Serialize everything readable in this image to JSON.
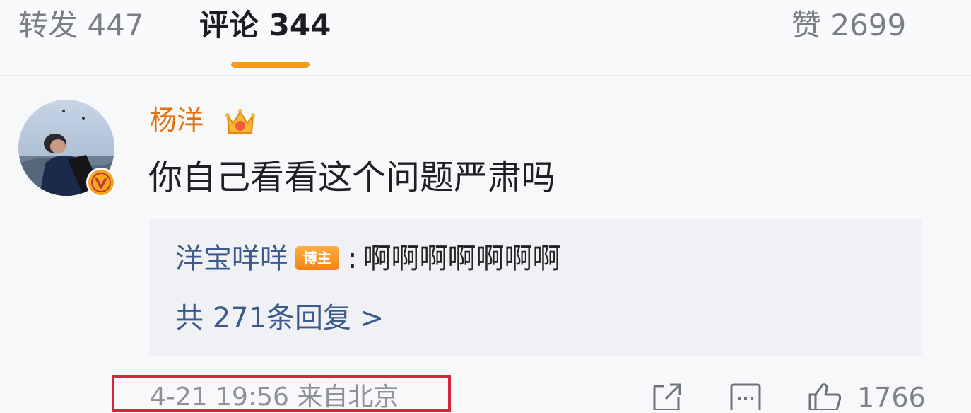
{
  "tabs": {
    "repost": "转发 447",
    "comments": "评论 344",
    "likes": "赞 2699"
  },
  "colors": {
    "accent": "#f49a1f",
    "username": "#e2730d",
    "link": "#3c5a8c",
    "highlight_box": "#d7263b"
  },
  "comment": {
    "author": "杨洋",
    "author_badge_icon": "crown-icon",
    "verified_icon": "v-badge-icon",
    "text": "你自己看看这个问题严肃吗",
    "reply_preview": {
      "author": "洋宝咩咩",
      "badge": "博主",
      "separator": ":",
      "text": "啊啊啊啊啊啊啊"
    },
    "more_replies": "共 271条回复 >",
    "meta": "4-21 19:56 来自北京",
    "actions": {
      "share_icon": "share-icon",
      "comment_icon": "comment-icon",
      "like_icon": "thumbs-up-icon",
      "like_count": "1766"
    }
  }
}
